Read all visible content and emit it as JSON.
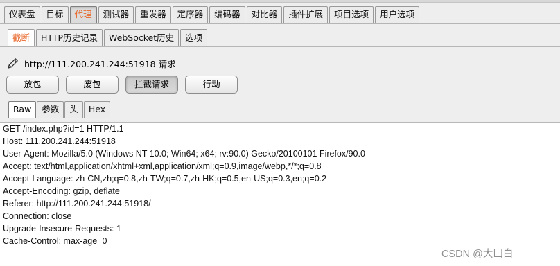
{
  "main_tabs": [
    {
      "label": "仪表盘",
      "active": false
    },
    {
      "label": "目标",
      "active": false
    },
    {
      "label": "代理",
      "active": true
    },
    {
      "label": "测试器",
      "active": false
    },
    {
      "label": "重发器",
      "active": false
    },
    {
      "label": "定序器",
      "active": false
    },
    {
      "label": "编码器",
      "active": false
    },
    {
      "label": "对比器",
      "active": false
    },
    {
      "label": "插件扩展",
      "active": false
    },
    {
      "label": "项目选项",
      "active": false
    },
    {
      "label": "用户选项",
      "active": false
    }
  ],
  "proxy_tabs": [
    {
      "label": "截断",
      "active": true
    },
    {
      "label": "HTTP历史记录",
      "active": false
    },
    {
      "label": "WebSocket历史",
      "active": false
    },
    {
      "label": "选项",
      "active": false
    }
  ],
  "intercept": {
    "title": "http://111.200.241.244:51918 请求",
    "buttons": [
      {
        "label": "放包",
        "pressed": false
      },
      {
        "label": "废包",
        "pressed": false
      },
      {
        "label": "拦截请求",
        "pressed": true
      },
      {
        "label": "行动",
        "pressed": false
      }
    ]
  },
  "view_tabs": [
    {
      "label": "Raw",
      "active": true
    },
    {
      "label": "参数",
      "active": false
    },
    {
      "label": "头",
      "active": false
    },
    {
      "label": "Hex",
      "active": false
    }
  ],
  "request_lines": [
    "GET /index.php?id=1 HTTP/1.1",
    "Host: 111.200.241.244:51918",
    "User-Agent: Mozilla/5.0 (Windows NT 10.0; Win64; x64; rv:90.0) Gecko/20100101 Firefox/90.0",
    "Accept: text/html,application/xhtml+xml,application/xml;q=0.9,image/webp,*/*;q=0.8",
    "Accept-Language: zh-CN,zh;q=0.8,zh-TW;q=0.7,zh-HK;q=0.5,en-US;q=0.3,en;q=0.2",
    "Accept-Encoding: gzip, deflate",
    "Referer: http://111.200.241.244:51918/",
    "Connection: close",
    "Upgrade-Insecure-Requests: 1",
    "Cache-Control: max-age=0"
  ],
  "watermark": "CSDN @大凵白",
  "colors": {
    "active_tab_text": "#e8682b"
  }
}
